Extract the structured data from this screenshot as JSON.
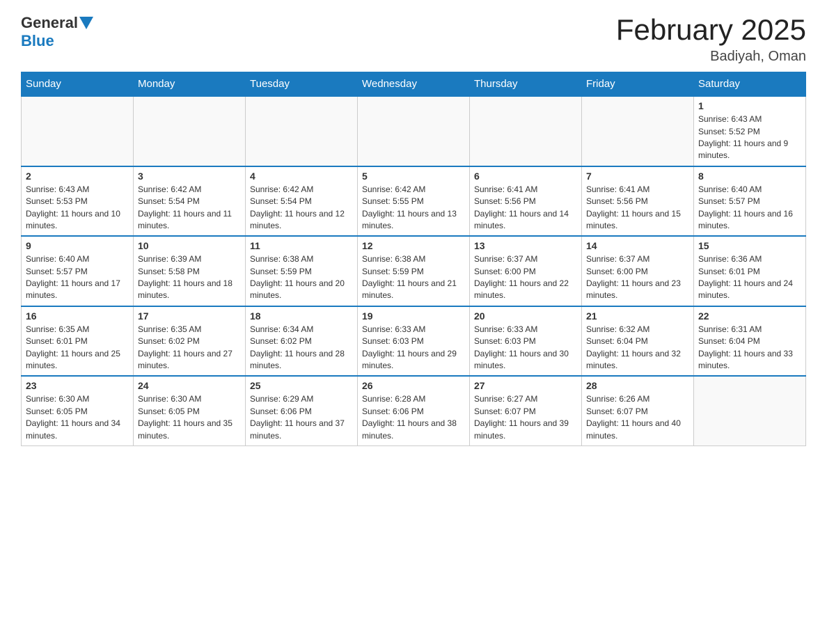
{
  "header": {
    "logo": {
      "general": "General",
      "blue": "Blue"
    },
    "title": "February 2025",
    "location": "Badiyah, Oman"
  },
  "days_of_week": [
    "Sunday",
    "Monday",
    "Tuesday",
    "Wednesday",
    "Thursday",
    "Friday",
    "Saturday"
  ],
  "weeks": [
    [
      {
        "day": "",
        "info": ""
      },
      {
        "day": "",
        "info": ""
      },
      {
        "day": "",
        "info": ""
      },
      {
        "day": "",
        "info": ""
      },
      {
        "day": "",
        "info": ""
      },
      {
        "day": "",
        "info": ""
      },
      {
        "day": "1",
        "info": "Sunrise: 6:43 AM\nSunset: 5:52 PM\nDaylight: 11 hours and 9 minutes."
      }
    ],
    [
      {
        "day": "2",
        "info": "Sunrise: 6:43 AM\nSunset: 5:53 PM\nDaylight: 11 hours and 10 minutes."
      },
      {
        "day": "3",
        "info": "Sunrise: 6:42 AM\nSunset: 5:54 PM\nDaylight: 11 hours and 11 minutes."
      },
      {
        "day": "4",
        "info": "Sunrise: 6:42 AM\nSunset: 5:54 PM\nDaylight: 11 hours and 12 minutes."
      },
      {
        "day": "5",
        "info": "Sunrise: 6:42 AM\nSunset: 5:55 PM\nDaylight: 11 hours and 13 minutes."
      },
      {
        "day": "6",
        "info": "Sunrise: 6:41 AM\nSunset: 5:56 PM\nDaylight: 11 hours and 14 minutes."
      },
      {
        "day": "7",
        "info": "Sunrise: 6:41 AM\nSunset: 5:56 PM\nDaylight: 11 hours and 15 minutes."
      },
      {
        "day": "8",
        "info": "Sunrise: 6:40 AM\nSunset: 5:57 PM\nDaylight: 11 hours and 16 minutes."
      }
    ],
    [
      {
        "day": "9",
        "info": "Sunrise: 6:40 AM\nSunset: 5:57 PM\nDaylight: 11 hours and 17 minutes."
      },
      {
        "day": "10",
        "info": "Sunrise: 6:39 AM\nSunset: 5:58 PM\nDaylight: 11 hours and 18 minutes."
      },
      {
        "day": "11",
        "info": "Sunrise: 6:38 AM\nSunset: 5:59 PM\nDaylight: 11 hours and 20 minutes."
      },
      {
        "day": "12",
        "info": "Sunrise: 6:38 AM\nSunset: 5:59 PM\nDaylight: 11 hours and 21 minutes."
      },
      {
        "day": "13",
        "info": "Sunrise: 6:37 AM\nSunset: 6:00 PM\nDaylight: 11 hours and 22 minutes."
      },
      {
        "day": "14",
        "info": "Sunrise: 6:37 AM\nSunset: 6:00 PM\nDaylight: 11 hours and 23 minutes."
      },
      {
        "day": "15",
        "info": "Sunrise: 6:36 AM\nSunset: 6:01 PM\nDaylight: 11 hours and 24 minutes."
      }
    ],
    [
      {
        "day": "16",
        "info": "Sunrise: 6:35 AM\nSunset: 6:01 PM\nDaylight: 11 hours and 25 minutes."
      },
      {
        "day": "17",
        "info": "Sunrise: 6:35 AM\nSunset: 6:02 PM\nDaylight: 11 hours and 27 minutes."
      },
      {
        "day": "18",
        "info": "Sunrise: 6:34 AM\nSunset: 6:02 PM\nDaylight: 11 hours and 28 minutes."
      },
      {
        "day": "19",
        "info": "Sunrise: 6:33 AM\nSunset: 6:03 PM\nDaylight: 11 hours and 29 minutes."
      },
      {
        "day": "20",
        "info": "Sunrise: 6:33 AM\nSunset: 6:03 PM\nDaylight: 11 hours and 30 minutes."
      },
      {
        "day": "21",
        "info": "Sunrise: 6:32 AM\nSunset: 6:04 PM\nDaylight: 11 hours and 32 minutes."
      },
      {
        "day": "22",
        "info": "Sunrise: 6:31 AM\nSunset: 6:04 PM\nDaylight: 11 hours and 33 minutes."
      }
    ],
    [
      {
        "day": "23",
        "info": "Sunrise: 6:30 AM\nSunset: 6:05 PM\nDaylight: 11 hours and 34 minutes."
      },
      {
        "day": "24",
        "info": "Sunrise: 6:30 AM\nSunset: 6:05 PM\nDaylight: 11 hours and 35 minutes."
      },
      {
        "day": "25",
        "info": "Sunrise: 6:29 AM\nSunset: 6:06 PM\nDaylight: 11 hours and 37 minutes."
      },
      {
        "day": "26",
        "info": "Sunrise: 6:28 AM\nSunset: 6:06 PM\nDaylight: 11 hours and 38 minutes."
      },
      {
        "day": "27",
        "info": "Sunrise: 6:27 AM\nSunset: 6:07 PM\nDaylight: 11 hours and 39 minutes."
      },
      {
        "day": "28",
        "info": "Sunrise: 6:26 AM\nSunset: 6:07 PM\nDaylight: 11 hours and 40 minutes."
      },
      {
        "day": "",
        "info": ""
      }
    ]
  ]
}
